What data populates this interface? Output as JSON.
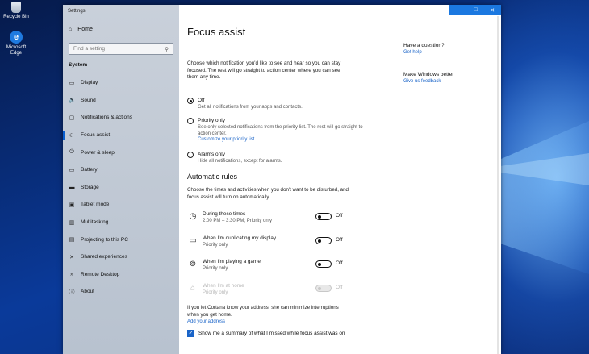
{
  "desktop": {
    "icons": [
      {
        "label": "Recycle Bin",
        "icon": "recycle-bin-icon"
      },
      {
        "label": "Microsoft Edge",
        "icon": "edge-icon"
      }
    ]
  },
  "window": {
    "app_title": "Settings",
    "controls": {
      "minimize": "—",
      "maximize": "□",
      "close": "✕"
    }
  },
  "sidebar": {
    "home_label": "Home",
    "search_placeholder": "Find a setting",
    "section_label": "System",
    "items": [
      {
        "label": "Display",
        "icon": "display-icon",
        "glyph": "▭"
      },
      {
        "label": "Sound",
        "icon": "sound-icon",
        "glyph": "🔈"
      },
      {
        "label": "Notifications & actions",
        "icon": "notifications-icon",
        "glyph": "▢"
      },
      {
        "label": "Focus assist",
        "icon": "moon-icon",
        "glyph": "☾"
      },
      {
        "label": "Power & sleep",
        "icon": "power-icon",
        "glyph": "⏻"
      },
      {
        "label": "Battery",
        "icon": "battery-icon",
        "glyph": "▭"
      },
      {
        "label": "Storage",
        "icon": "storage-icon",
        "glyph": "▬"
      },
      {
        "label": "Tablet mode",
        "icon": "tablet-icon",
        "glyph": "▣"
      },
      {
        "label": "Multitasking",
        "icon": "multitasking-icon",
        "glyph": "▥"
      },
      {
        "label": "Projecting to this PC",
        "icon": "projecting-icon",
        "glyph": "▤"
      },
      {
        "label": "Shared experiences",
        "icon": "shared-icon",
        "glyph": "✕"
      },
      {
        "label": "Remote Desktop",
        "icon": "remote-desktop-icon",
        "glyph": "»"
      },
      {
        "label": "About",
        "icon": "info-icon",
        "glyph": "ⓘ"
      }
    ],
    "active_index": 3
  },
  "main": {
    "title": "Focus assist",
    "description": "Choose which notification you'd like to see and hear so you can stay focused. The rest will go straight to action center where you can see them any time.",
    "options": [
      {
        "label": "Off",
        "sub": "Get all notifications from your apps and contacts.",
        "selected": true
      },
      {
        "label": "Priority only",
        "sub": "See only selected notifications from the priority list. The rest will go straight to action center.",
        "link": "Customize your priority list",
        "selected": false
      },
      {
        "label": "Alarms only",
        "sub": "Hide all notifications, except for alarms.",
        "selected": false
      }
    ],
    "rules_title": "Automatic rules",
    "rules_description": "Choose the times and activities when you don't want to be disturbed, and focus assist will turn on automatically.",
    "rules": [
      {
        "name": "During these times",
        "sub": "2:00 PM – 3:30 PM; Priority only",
        "state": "Off",
        "icon": "clock-icon",
        "glyph": "◷",
        "disabled": false
      },
      {
        "name": "When I'm duplicating my display",
        "sub": "Priority only",
        "state": "Off",
        "icon": "monitor-icon",
        "glyph": "▭",
        "disabled": false
      },
      {
        "name": "When I'm playing a game",
        "sub": "Priority only",
        "state": "Off",
        "icon": "gamepad-icon",
        "glyph": "⊚",
        "disabled": false
      },
      {
        "name": "When I'm at home",
        "sub": "Priority only",
        "state": "Off",
        "icon": "home-icon",
        "glyph": "⌂",
        "disabled": true
      }
    ],
    "cortana_text": "If you let Cortana know your address, she can minimize interruptions when you get home.",
    "cortana_link": "Add your address",
    "summary_label": "Show me a summary of what I missed while focus assist was on",
    "summary_checked": true
  },
  "side_panel": {
    "question_title": "Have a question?",
    "question_link": "Get help",
    "improve_title": "Make Windows better",
    "improve_link": "Give us feedback"
  }
}
